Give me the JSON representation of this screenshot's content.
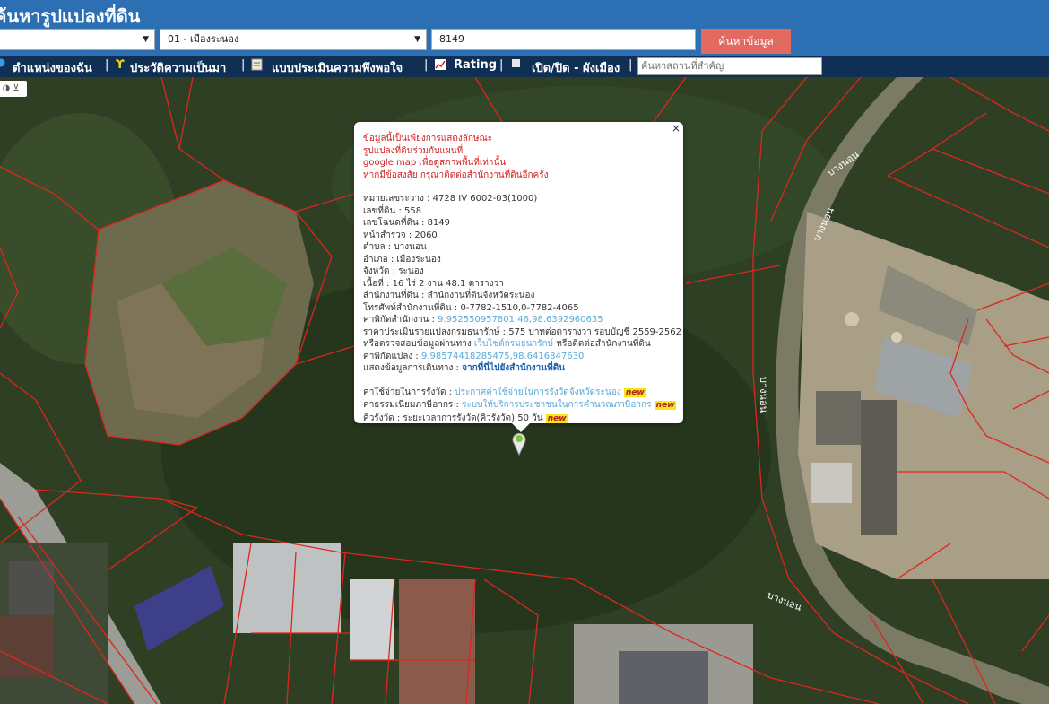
{
  "header": {
    "title": "ค้นหารูปแปลงที่ดิน",
    "province_select": "",
    "district_select": "01 - เมืองระนอง",
    "parcel_input": "8149",
    "search_button": "ค้นหาข้อมูล"
  },
  "navbar": {
    "items": [
      "ตำแหน่งของฉัน",
      "ประวัติความเป็นมา",
      "แบบประเมินความพึงพอใจ",
      "Rating",
      "เปิด/ปิด - ผังเมือง"
    ],
    "separator": "|",
    "place_search_placeholder": "ค้นหาสถานที่สำคัญ"
  },
  "map": {
    "road_labels": [
      "บางนอน",
      "บางนอน",
      "บางนอน",
      "บางนอน"
    ],
    "boundary_color": "#e0251e"
  },
  "popup": {
    "close": "×",
    "warning": [
      "ข้อมูลนี้เป็นเพียงการแสดงลักษณะ",
      "รูปแปลงที่ดินร่วมกับแผนที่",
      "google map เพื่อดูสภาพพื้นที่เท่านั้น",
      "หากมีข้อสงสัย กรุณาติดต่อสำนักงานที่ดินอีกครั้ง"
    ],
    "sheet": {
      "label": "หมายเลขระวาง",
      "value": "4728 IV 6002-03(1000)"
    },
    "land_no": {
      "label": "เลขที่ดิน",
      "value": "558"
    },
    "deed_no": {
      "label": "เลขโฉนดที่ดิน",
      "value": "8149"
    },
    "survey_page": {
      "label": "หน้าสำรวจ",
      "value": "2060"
    },
    "subdistrict": {
      "label": "ตำบล",
      "value": "บางนอน"
    },
    "district": {
      "label": "อำเภอ",
      "value": "เมืองระนอง"
    },
    "province": {
      "label": "จังหวัด",
      "value": "ระนอง"
    },
    "area": {
      "label": "เนื้อที่",
      "value": "16 ไร่ 2 งาน 48.1 ตารางวา"
    },
    "office": {
      "label": "สำนักงานที่ดิน",
      "value": "สำนักงานที่ดินจังหวัดระนอง"
    },
    "phone": {
      "label": "โทรศัพท์สำนักงานที่ดิน",
      "value": "0-7782-1510,0-7782-4065"
    },
    "office_coord": {
      "label": "ค่าพิกัดสำนักงาน",
      "value": "9.952550957801 46,98.6392960635"
    },
    "price": {
      "label": "ราคาประเมินรายแปลงกรมธนารักษ์",
      "value": "575 บาทต่อตารางวา รอบบัญชี 2559-2562"
    },
    "check": {
      "prefix": "หรือตรวจสอบข้อมูลผ่านทาง",
      "link": "เว็บไซต์กรมธนารักษ์",
      "suffix": "หรือติดต่อสำนักงานที่ดิน"
    },
    "parcel_coord": {
      "label": "ค่าพิกัดแปลง",
      "value": "9.98574418285475,98.6416847630"
    },
    "route": {
      "label": "แสดงข้อมูลการเดินทาง",
      "link": "จากที่นี่ไปยังสำนักงานที่ดิน"
    },
    "expense": {
      "label": "ค่าใช้จ่ายในการรังวัด",
      "link": "ประกาศค่าใช้จ่ายในการรังวัดจังหวัดระนอง"
    },
    "fee": {
      "label": "ค่าธรรมเนียมภาษีอากร",
      "link": "ระบบให้บริการประชาชนในการคำนวณภาษีอากร"
    },
    "queue": {
      "label": "คิวรังวัด",
      "value": "ระยะเวลาการรังวัด(คิวรังวัด) 50 วัน"
    },
    "new_badge": "new"
  }
}
